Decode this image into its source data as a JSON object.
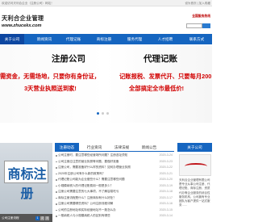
{
  "topbar": {
    "left": "欢迎访问天利合企业（注册公司）网站！",
    "right": "设为首页 | 加入收藏"
  },
  "header": {
    "site_name": "天利合企业管理",
    "site_url": "www.zhucekx.com",
    "hotline_label": "全国服务热线"
  },
  "nav": {
    "items": [
      {
        "label": "关于公司"
      },
      {
        "label": "新闻资讯"
      },
      {
        "label": "代理记账"
      },
      {
        "label": "商标注册"
      },
      {
        "label": "服务代理"
      },
      {
        "label": "人才招聘"
      },
      {
        "label": "联系方式"
      }
    ]
  },
  "banner": {
    "left_title": "注册公司",
    "right_title": "代理记账",
    "left_line1": "需资金，无需场地，只要你有身份证，",
    "left_line2": "3天营业执照送到家!",
    "right_line1": "记账报税、发票代开、只要每月200",
    "right_line2": "全部搞定全市最低价!"
  },
  "thumb": {
    "plaque_text": "商标注册",
    "caption": "公司注册流程",
    "pages": [
      "1",
      "2",
      "3"
    ]
  },
  "tabs": [
    {
      "label": "注册动态"
    },
    {
      "label": "行业资讯"
    },
    {
      "label": "法律法规"
    },
    {
      "label": "新闻公告"
    }
  ],
  "news": [
    {
      "title": "公司注册时，要注意哪些经营场所问题？注册选址须知",
      "date": "2020-3-24"
    },
    {
      "title": "公司注册应注意的营业执照等问题，要做好准备",
      "date": "2020-3-23"
    },
    {
      "title": "注册公司，需要准备好什么样的资料？如何办理营业执照",
      "date": "2020-3-22"
    },
    {
      "title": "2020年注册公司有什么新的政策吗？",
      "date": "2020-3-21"
    },
    {
      "title": "代理记账公司能为企业做些什么？需要注意哪些问题",
      "date": "2020-3-20"
    },
    {
      "title": "小规模纳税人的代理记账费用一般是多少？",
      "date": "2020-3-19"
    },
    {
      "title": "注册公司需要注意的七大事项，不了解容易吃亏",
      "date": "2020-3-18"
    },
    {
      "title": "商标注册流程是什么？注册商标有什么好处？",
      "date": "2020-3-17"
    },
    {
      "title": "注册公司需要哪些资料？公司注册流程详解",
      "date": "2020-3-16"
    },
    {
      "title": "公司的注册地址和实际经营地址不一致怎么办",
      "date": "2020-3-15"
    },
    {
      "title": "一般纳税人与小规模纳税人的区别有哪些",
      "date": "2020-3-14"
    }
  ],
  "about": {
    "heading": "关于公司",
    "text": "天利合企业管理有限公司是专业从事公司注册、代理记账、商标注册、资质代办等企业服务的综合性服务机构，公司拥有专业团队为客户提供一站式服务……"
  },
  "colors": {
    "nav_blue": "#1565c0",
    "banner_red": "#c0151a",
    "slogan_red": "#d10000"
  }
}
